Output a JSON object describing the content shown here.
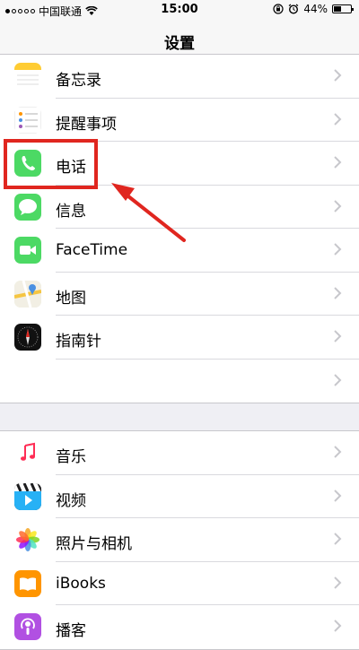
{
  "status_bar": {
    "carrier": "中国联通",
    "time": "15:00",
    "battery": "44%",
    "battery_level": 0.44
  },
  "nav": {
    "title": "设置"
  },
  "group1": {
    "items": [
      {
        "label": "备忘录",
        "icon": "notes-icon"
      },
      {
        "label": "提醒事项",
        "icon": "reminders-icon"
      },
      {
        "label": "电话",
        "icon": "phone-icon"
      },
      {
        "label": "信息",
        "icon": "messages-icon"
      },
      {
        "label": "FaceTime",
        "icon": "facetime-icon"
      },
      {
        "label": "地图",
        "icon": "maps-icon"
      },
      {
        "label": "指南针",
        "icon": "compass-icon"
      },
      {
        "label": "",
        "icon": ""
      }
    ]
  },
  "group2": {
    "items": [
      {
        "label": "音乐",
        "icon": "music-icon"
      },
      {
        "label": "视频",
        "icon": "videos-icon"
      },
      {
        "label": "照片与相机",
        "icon": "photos-icon"
      },
      {
        "label": "iBooks",
        "icon": "ibooks-icon"
      },
      {
        "label": "播客",
        "icon": "podcasts-icon"
      }
    ]
  },
  "colors": {
    "phone_green": "#4cd964",
    "facetime_green": "#4cd964",
    "highlight_red": "#e0261f",
    "ibooks_orange": "#ff9500",
    "podcasts_purple": "#b150e2"
  }
}
